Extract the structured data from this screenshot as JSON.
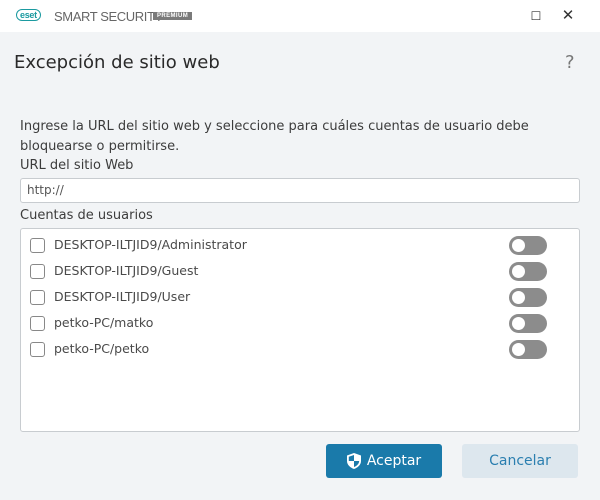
{
  "window": {
    "logo": "eset",
    "brand": "SMART SECURITY",
    "edition": "PREMIUM",
    "minimize": "☐",
    "close": "✕"
  },
  "dialog": {
    "title": "Excepción de sitio web",
    "help": "?",
    "description": "Ingrese la URL del sitio web y seleccione para cuáles cuentas de usuario debe bloquearse o permitirse.",
    "url_label": "URL del sitio Web",
    "url_value": "http://",
    "accounts_label": "Cuentas de usuarios",
    "accounts": [
      {
        "name": "DESKTOP-ILTJID9/Administrator",
        "checked": false,
        "enabled": false
      },
      {
        "name": "DESKTOP-ILTJID9/Guest",
        "checked": false,
        "enabled": false
      },
      {
        "name": "DESKTOP-ILTJID9/User",
        "checked": false,
        "enabled": false
      },
      {
        "name": "petko-PC/matko",
        "checked": false,
        "enabled": false
      },
      {
        "name": "petko-PC/petko",
        "checked": false,
        "enabled": false
      }
    ],
    "accept": "Aceptar",
    "cancel": "Cancelar"
  },
  "colors": {
    "accent": "#1a7aaa",
    "brand": "#1b9aa0"
  }
}
